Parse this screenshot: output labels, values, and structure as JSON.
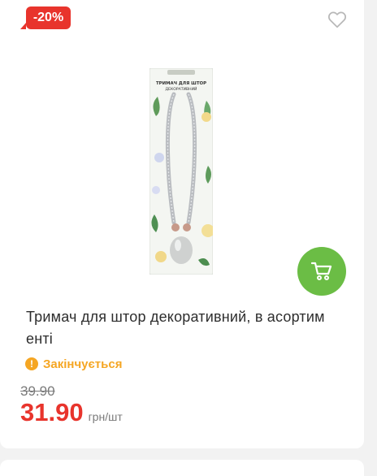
{
  "product": {
    "discount_badge": "-20%",
    "image_label_top": "ТРИМАЧ ДЛЯ ШТОР",
    "image_label_bottom": "ДЕКОРАТИВНИЙ",
    "title": "Тримач для штор декоративний, в асортим енті",
    "stock_status": "Закінчується",
    "old_price": "39.90",
    "price": "31.90",
    "unit": "грн/шт"
  },
  "icons": {
    "wishlist": "heart-outline-icon",
    "cart": "shopping-cart-icon",
    "status": "exclamation-circle-icon"
  },
  "colors": {
    "discount_red": "#e8342c",
    "cart_green": "#6bbd45",
    "status_orange": "#f5a623"
  }
}
